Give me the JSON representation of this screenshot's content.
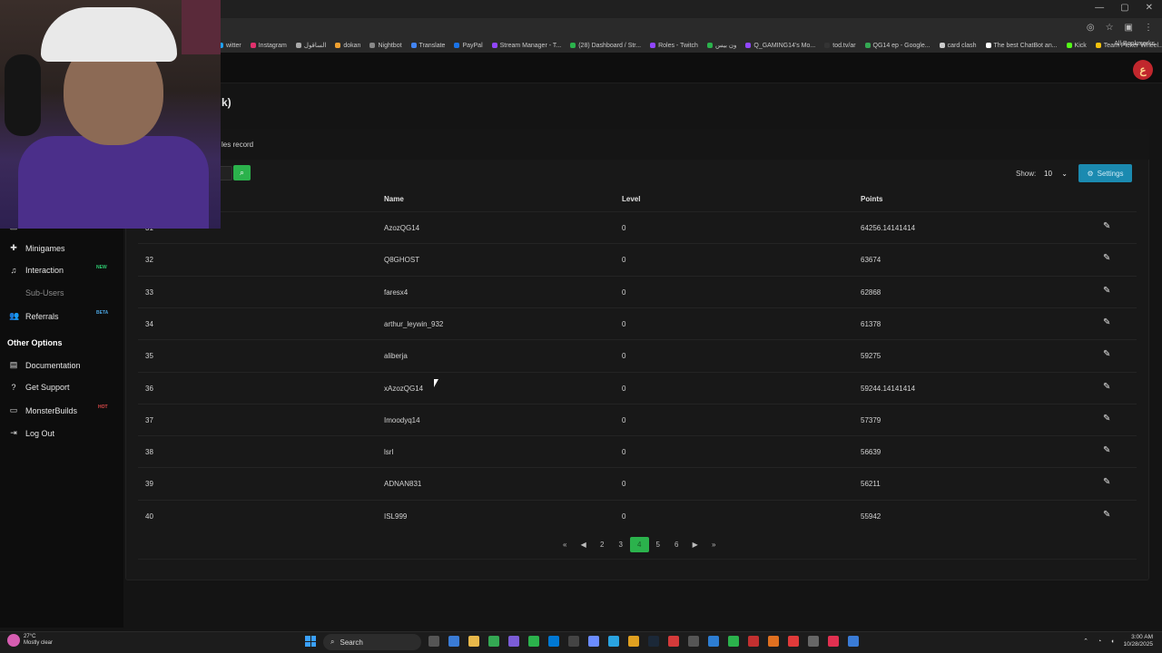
{
  "browser": {
    "bookmarks": [
      {
        "label": "witter",
        "color": "#1da1f2"
      },
      {
        "label": "Instagram",
        "color": "#e1306c"
      },
      {
        "label": "الساقول",
        "color": "#aaaaaa"
      },
      {
        "label": "dokan",
        "color": "#f0a030"
      },
      {
        "label": "Nightbot",
        "color": "#888888"
      },
      {
        "label": "Translate",
        "color": "#4285f4"
      },
      {
        "label": "PayPal",
        "color": "#1a73e8"
      },
      {
        "label": "Stream Manager - T...",
        "color": "#9146ff"
      },
      {
        "label": "(28) Dashboard / Str...",
        "color": "#2bb24c"
      },
      {
        "label": "Roles - Twitch",
        "color": "#9146ff"
      },
      {
        "label": "ون بيس",
        "color": "#2bb24c"
      },
      {
        "label": "Q_GAMING14's Mo...",
        "color": "#9146ff"
      },
      {
        "label": "tod.tv/ar",
        "color": "#333333"
      },
      {
        "label": "QG14 ep - Google...",
        "color": "#34a853"
      },
      {
        "label": "card clash",
        "color": "#cccccc"
      },
      {
        "label": "The best ChatBot an...",
        "color": "#ffffff"
      },
      {
        "label": "Kick",
        "color": "#53fc18"
      },
      {
        "label": "Team Picker Wheel...",
        "color": "#f4c20d"
      }
    ],
    "all_bookmarks": "All Bookmarks"
  },
  "page": {
    "title": "k)",
    "tab_label": "les record"
  },
  "sidebar": {
    "items": [
      {
        "label": "Minigames",
        "icon": "gamepad-icon"
      },
      {
        "label": "Interaction",
        "icon": "music-icon",
        "badge": "NEW"
      },
      {
        "label": "Sub-Users",
        "icon": "",
        "disabled": true
      },
      {
        "label": "Referrals",
        "icon": "users-icon",
        "badge": "BETA"
      }
    ],
    "section_title": "Other Options",
    "other": [
      {
        "label": "Documentation",
        "icon": "book-icon"
      },
      {
        "label": "Get Support",
        "icon": "question-icon"
      },
      {
        "label": "MonsterBuilds",
        "icon": "laptop-icon",
        "badge": "HOT"
      },
      {
        "label": "Log Out",
        "icon": "logout-icon"
      }
    ]
  },
  "toolbar": {
    "show_label": "Show:",
    "show_value": "10",
    "settings_label": "Settings"
  },
  "table": {
    "headers": {
      "name": "Name",
      "level": "Level",
      "points": "Points"
    },
    "rows": [
      {
        "rank": "31",
        "name": "AzozQG14",
        "level": "0",
        "points": "64256.14141414"
      },
      {
        "rank": "32",
        "name": "Q8GHOST",
        "level": "0",
        "points": "63674"
      },
      {
        "rank": "33",
        "name": "faresx4",
        "level": "0",
        "points": "62868"
      },
      {
        "rank": "34",
        "name": "arthur_leywin_932",
        "level": "0",
        "points": "61378"
      },
      {
        "rank": "35",
        "name": "aliberja",
        "level": "0",
        "points": "59275"
      },
      {
        "rank": "36",
        "name": "xAzozQG14",
        "level": "0",
        "points": "59244.14141414"
      },
      {
        "rank": "37",
        "name": "Imoodyq14",
        "level": "0",
        "points": "57379"
      },
      {
        "rank": "38",
        "name": "lsrl",
        "level": "0",
        "points": "56639"
      },
      {
        "rank": "39",
        "name": "ADNAN831",
        "level": "0",
        "points": "56211"
      },
      {
        "rank": "40",
        "name": "ISL999",
        "level": "0",
        "points": "55942"
      }
    ]
  },
  "pagination": {
    "pages": [
      "2",
      "3",
      "4",
      "5",
      "6"
    ],
    "active": "4"
  },
  "taskbar": {
    "temp": "27°C",
    "weather": "Mostly clear",
    "search": "Search",
    "time": "3:00 AM",
    "date": "10/28/2025"
  },
  "colors": {
    "accent_green": "#2bb24c",
    "settings_blue": "#1b8ab0"
  }
}
